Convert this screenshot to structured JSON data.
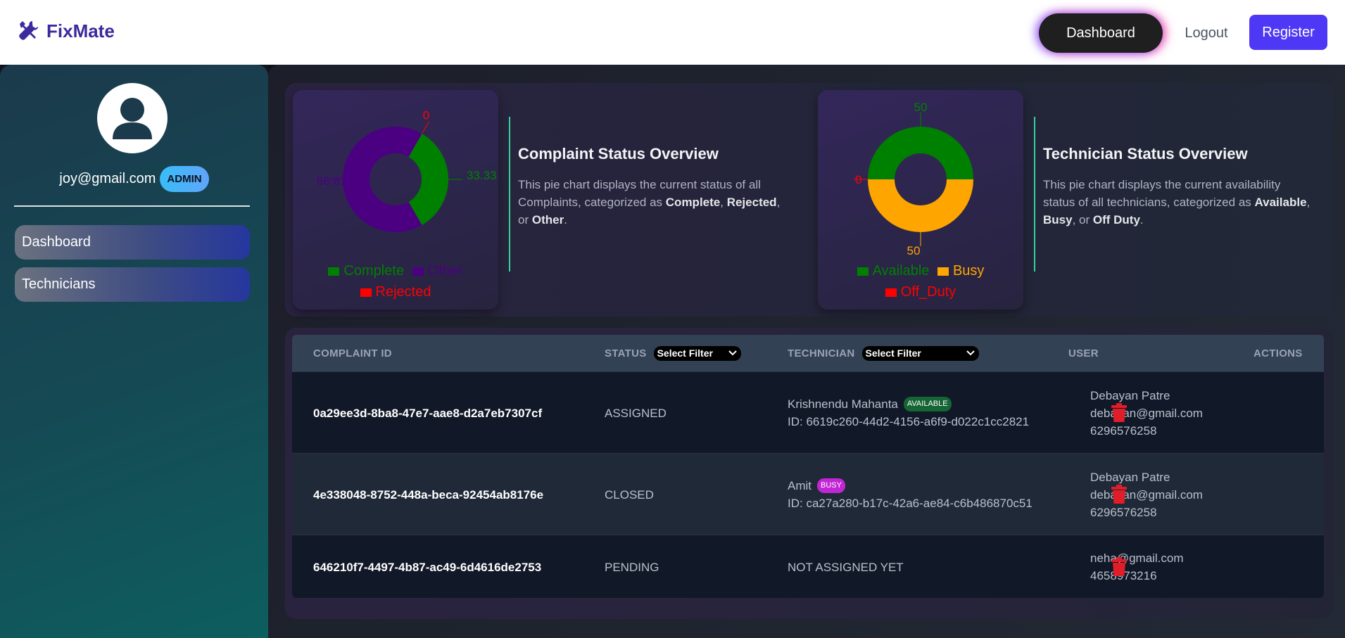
{
  "app": {
    "name": "FixMate"
  },
  "nav": {
    "dashboard": "Dashboard",
    "logout": "Logout",
    "register": "Register"
  },
  "sidebar": {
    "email": "joy@gmail.com",
    "role_badge": "ADMIN",
    "items": [
      {
        "label": "Dashboard"
      },
      {
        "label": "Technicians"
      }
    ]
  },
  "complaint_chart": {
    "title": "Complaint Status Overview",
    "desc_prefix": "This pie chart displays the current status of all Complaints, categorized as ",
    "labels": [
      "Complete",
      "Rejected",
      "Other"
    ],
    "slice_labels": [
      "33.33",
      "0",
      "66.67"
    ],
    "legend": [
      "Complete",
      "Other",
      "Rejected"
    ]
  },
  "technician_chart": {
    "title": "Technician Status Overview",
    "desc_prefix": "This pie chart displays the current availability status of all technicians, categorized as ",
    "labels": [
      "Available",
      "Busy",
      "Off Duty"
    ],
    "slice_labels": [
      "50",
      "0",
      "50"
    ],
    "legend": [
      "Available",
      "Busy",
      "Off_Duty"
    ]
  },
  "chart_data": [
    {
      "type": "pie",
      "categories": [
        "Complete",
        "Other",
        "Rejected"
      ],
      "values": [
        33.33,
        66.67,
        0
      ],
      "colors": [
        "#008000",
        "#4b0082",
        "#ff0000"
      ],
      "legend_position": "bottom"
    },
    {
      "type": "pie",
      "categories": [
        "Available",
        "Busy",
        "Off_Duty"
      ],
      "values": [
        50,
        50,
        0
      ],
      "colors": [
        "#008000",
        "#ffa500",
        "#ff0000"
      ],
      "legend_position": "bottom"
    }
  ],
  "table": {
    "headers": {
      "id": "COMPLAINT ID",
      "status": "STATUS",
      "technician": "TECHNICIAN",
      "user": "USER",
      "actions": "ACTIONS"
    },
    "status_filter": "Select Filter",
    "technician_filter": "Select Filter",
    "rows": [
      {
        "id": "0a29ee3d-8ba8-47e7-aae8-d2a7eb7307cf",
        "status": "ASSIGNED",
        "tech_name": "Krishnendu Mahanta",
        "tech_badge": "AVAILABLE",
        "tech_id": "ID: 6619c260-44d2-4156-a6f9-d022c1cc2821",
        "user_name": "Debayan Patre",
        "user_email": "debayan@gmail.com",
        "user_phone": "6296576258"
      },
      {
        "id": "4e338048-8752-448a-beca-92454ab8176e",
        "status": "CLOSED",
        "tech_name": "Amit",
        "tech_badge": "BUSY",
        "tech_id": "ID: ca27a280-b17c-42a6-ae84-c6b486870c51",
        "user_name": "Debayan Patre",
        "user_email": "debayan@gmail.com",
        "user_phone": "6296576258"
      },
      {
        "id": "646210f7-4497-4b87-ac49-6d4616de2753",
        "status": "PENDING",
        "tech_unassigned": "NOT ASSIGNED YET",
        "user_email": "neha@gmail.com",
        "user_phone": "4658973216"
      }
    ]
  },
  "colors": {
    "brand": "#3b2a9e",
    "register": "#4f38f5",
    "divider": "#34d399",
    "delete": "#e11d2a"
  }
}
